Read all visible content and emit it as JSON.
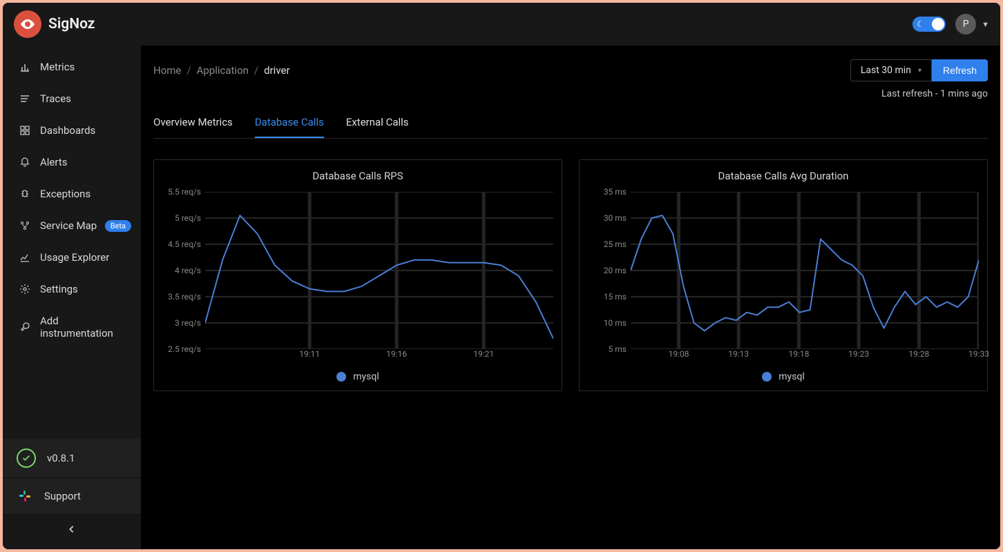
{
  "app_name": "SigNoz",
  "titlebar": {
    "avatar_initial": "P"
  },
  "sidebar": {
    "items": [
      {
        "icon": "bar-chart-icon",
        "label": "Metrics"
      },
      {
        "icon": "menu-icon",
        "label": "Traces"
      },
      {
        "icon": "grid-icon",
        "label": "Dashboards"
      },
      {
        "icon": "bell-icon",
        "label": "Alerts"
      },
      {
        "icon": "bug-icon",
        "label": "Exceptions"
      },
      {
        "icon": "branch-icon",
        "label": "Service Map",
        "badge": "Beta"
      },
      {
        "icon": "line-chart-icon",
        "label": "Usage Explorer"
      },
      {
        "icon": "gear-icon",
        "label": "Settings"
      },
      {
        "icon": "wrench-icon",
        "label": "Add instrumentation"
      }
    ],
    "version": "v0.8.1",
    "support": "Support"
  },
  "breadcrumbs": {
    "home": "Home",
    "application": "Application",
    "current": "driver"
  },
  "time_range": "Last 30 min",
  "refresh_label": "Refresh",
  "last_refresh": "Last refresh - 1 mins ago",
  "tabs": [
    {
      "label": "Overview Metrics",
      "active": false
    },
    {
      "label": "Database Calls",
      "active": true
    },
    {
      "label": "External Calls",
      "active": false
    }
  ],
  "charts": [
    {
      "title": "Database Calls RPS",
      "legend": "mysql"
    },
    {
      "title": "Database Calls Avg Duration",
      "legend": "mysql"
    }
  ],
  "chart_data": [
    {
      "type": "line",
      "title": "Database Calls RPS",
      "ylabel": "req/s",
      "ylim": [
        2.5,
        5.5
      ],
      "y_ticks": [
        "5.5 req/s",
        "5 req/s",
        "4.5 req/s",
        "4 req/s",
        "3.5 req/s",
        "3 req/s",
        "2.5 req/s"
      ],
      "x_ticks": [
        "19:11",
        "19:16",
        "19:21"
      ],
      "series": [
        {
          "name": "mysql",
          "x": [
            "19:05",
            "19:06",
            "19:07",
            "19:08",
            "19:09",
            "19:10",
            "19:11",
            "19:12",
            "19:13",
            "19:14",
            "19:15",
            "19:16",
            "19:17",
            "19:18",
            "19:19",
            "19:20",
            "19:21",
            "19:22",
            "19:23",
            "19:24",
            "19:25"
          ],
          "values": [
            3.0,
            4.2,
            5.05,
            4.7,
            4.1,
            3.8,
            3.65,
            3.6,
            3.6,
            3.7,
            3.9,
            4.1,
            4.2,
            4.2,
            4.15,
            4.15,
            4.15,
            4.1,
            3.9,
            3.4,
            2.7
          ]
        }
      ]
    },
    {
      "type": "line",
      "title": "Database Calls Avg Duration",
      "ylabel": "ms",
      "ylim": [
        5,
        35
      ],
      "y_ticks": [
        "35 ms",
        "30 ms",
        "25 ms",
        "20 ms",
        "15 ms",
        "10 ms",
        "5 ms"
      ],
      "x_ticks": [
        "19:08",
        "19:13",
        "19:18",
        "19:23",
        "19:28",
        "19:33"
      ],
      "series": [
        {
          "name": "mysql",
          "x": [
            "19:04",
            "19:05",
            "19:06",
            "19:07",
            "19:08",
            "19:09",
            "19:10",
            "19:11",
            "19:12",
            "19:13",
            "19:14",
            "19:15",
            "19:16",
            "19:17",
            "19:18",
            "19:19",
            "19:20",
            "19:21",
            "19:22",
            "19:23",
            "19:24",
            "19:25",
            "19:26",
            "19:27",
            "19:28",
            "19:29",
            "19:30",
            "19:31",
            "19:32",
            "19:33"
          ],
          "values": [
            20,
            26,
            30,
            30.5,
            27,
            17,
            10,
            8.5,
            10,
            11,
            10.5,
            12,
            11.5,
            13,
            13,
            14,
            12,
            12.5,
            26,
            24,
            22,
            21,
            19,
            13,
            9,
            13,
            16,
            13.5,
            15,
            13,
            14,
            13,
            15,
            22
          ]
        }
      ]
    }
  ]
}
